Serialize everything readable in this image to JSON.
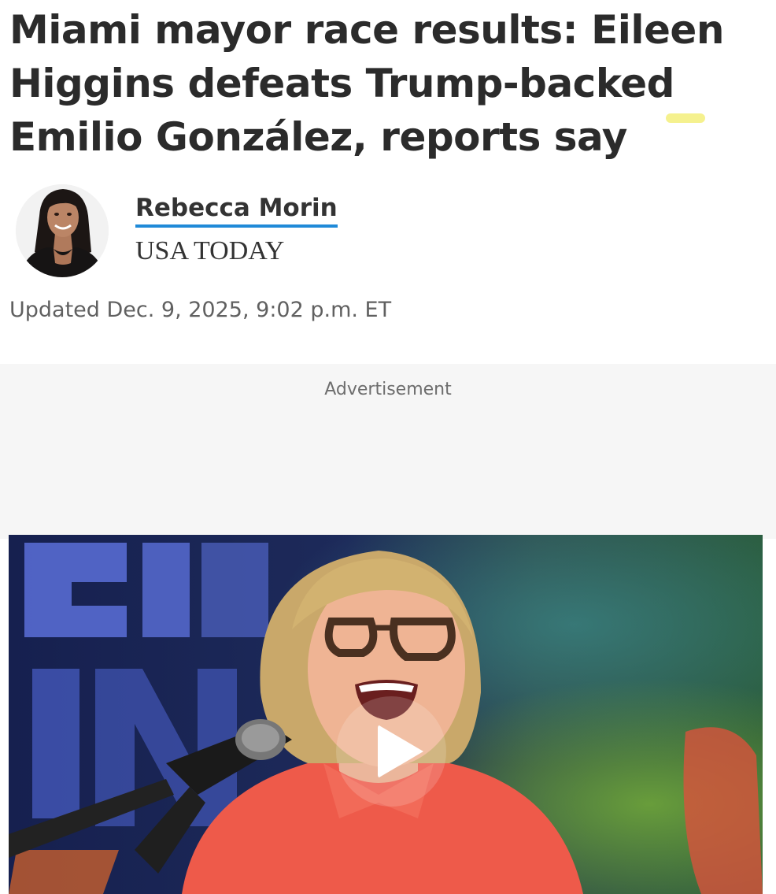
{
  "article": {
    "headline": "Miami mayor race results: Eileen Higgins defeats Trump-backed Emilio González, reports say",
    "author": {
      "name": "Rebecca Morin",
      "publication": "USA TODAY"
    },
    "updated": "Updated Dec. 9, 2025, 9:02 p.m. ET"
  },
  "advertisement": {
    "label": "Advertisement"
  },
  "video": {
    "play_icon": "play-icon"
  },
  "colors": {
    "author_underline": "#1f8ad8",
    "headline_text": "#2b2b2b",
    "highlight": "#f3ef7a"
  }
}
